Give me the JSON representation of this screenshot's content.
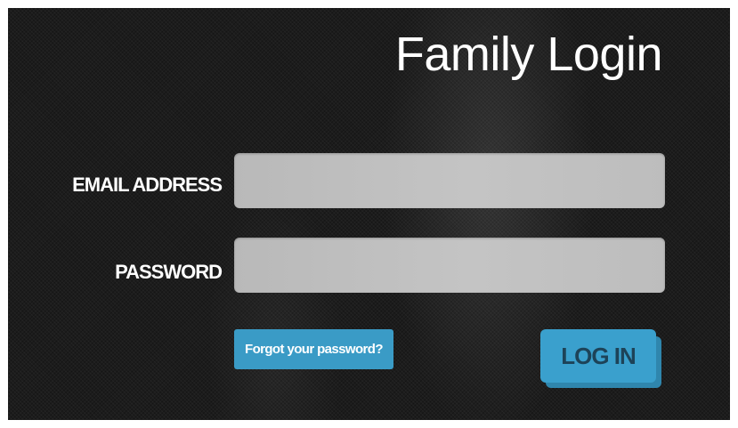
{
  "header": {
    "title": "Family Login"
  },
  "form": {
    "email_label": "EMAIL ADDRESS",
    "email_value": "",
    "password_label": "PASSWORD",
    "password_value": "",
    "forgot_label": "Forgot your password?",
    "login_label": "LOG IN"
  },
  "colors": {
    "background": "#1c1c1c",
    "input_fill": "#c0c0c0",
    "accent": "#3aa0cd",
    "login_text": "#1d4358"
  }
}
